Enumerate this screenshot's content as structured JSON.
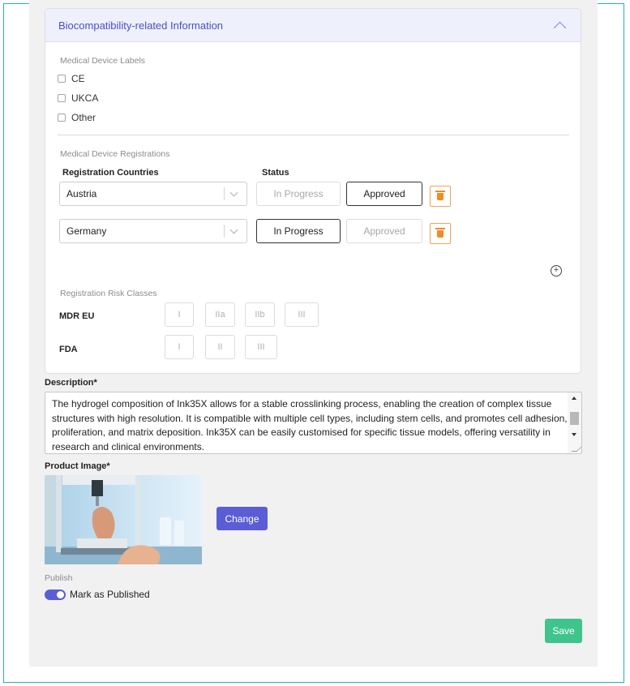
{
  "card": {
    "title": "Biocompatibility-related Information",
    "labels_section": "Medical Device Labels",
    "labels": [
      "CE",
      "UKCA",
      "Other"
    ],
    "registrations_section": "Medical Device Registrations",
    "col_countries": "Registration Countries",
    "col_status": "Status",
    "registrations": [
      {
        "country": "Austria",
        "status_in_progress": "In Progress",
        "status_approved": "Approved",
        "selected": "Approved"
      },
      {
        "country": "Germany",
        "status_in_progress": "In Progress",
        "status_approved": "Approved",
        "selected": "In Progress"
      }
    ],
    "add_icon": "plus-circle-icon",
    "risk_section": "Registration Risk Classes",
    "risk": {
      "mdr_label": "MDR EU",
      "mdr_classes": [
        "I",
        "IIa",
        "IIb",
        "III"
      ],
      "fda_label": "FDA",
      "fda_classes": [
        "I",
        "II",
        "III"
      ]
    }
  },
  "description": {
    "label": "Description*",
    "text": "The hydrogel composition of Ink35X allows for a stable crosslinking process, enabling the creation of complex tissue structures with high resolution. It is compatible with multiple cell types, including stem cells, and promotes cell adhesion, proliferation, and matrix deposition. Ink35X can be easily customised for specific tissue models, offering versatility in research and clinical environments."
  },
  "product_image": {
    "label": "Product Image*",
    "change_label": "Change"
  },
  "publish": {
    "label": "Publish",
    "toggle_label": "Mark as Published",
    "on": true
  },
  "save_label": "Save",
  "colors": {
    "accent": "#5b5dd6",
    "save": "#3fc48c",
    "delete": "#f08b25",
    "frame": "#27b3b0"
  }
}
